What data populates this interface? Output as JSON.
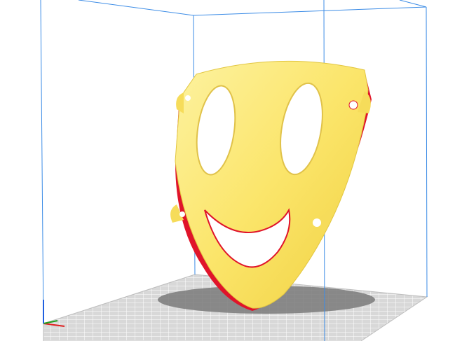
{
  "viewport": {
    "background_color": "#ffffff",
    "build_volume_color": "#3c8ce6",
    "build_plate_color": "#d8d8d8",
    "build_plate_grid_color": "#ffffff",
    "model_color": "#fce868",
    "model_shade_color": "#e8c83c",
    "model_shadow_color": "#7a7a7a",
    "overhang_color": "#e0142a",
    "axis_x_color": "#e02020",
    "axis_y_color": "#20a020",
    "axis_z_color": "#2060e0"
  },
  "model": {
    "name": "smiley-mask",
    "holes": [
      "left-eye",
      "right-eye",
      "mouth",
      "left-strap-hole-upper",
      "left-strap-hole-lower",
      "right-strap-hole-upper",
      "right-strap-hole-lower"
    ]
  }
}
